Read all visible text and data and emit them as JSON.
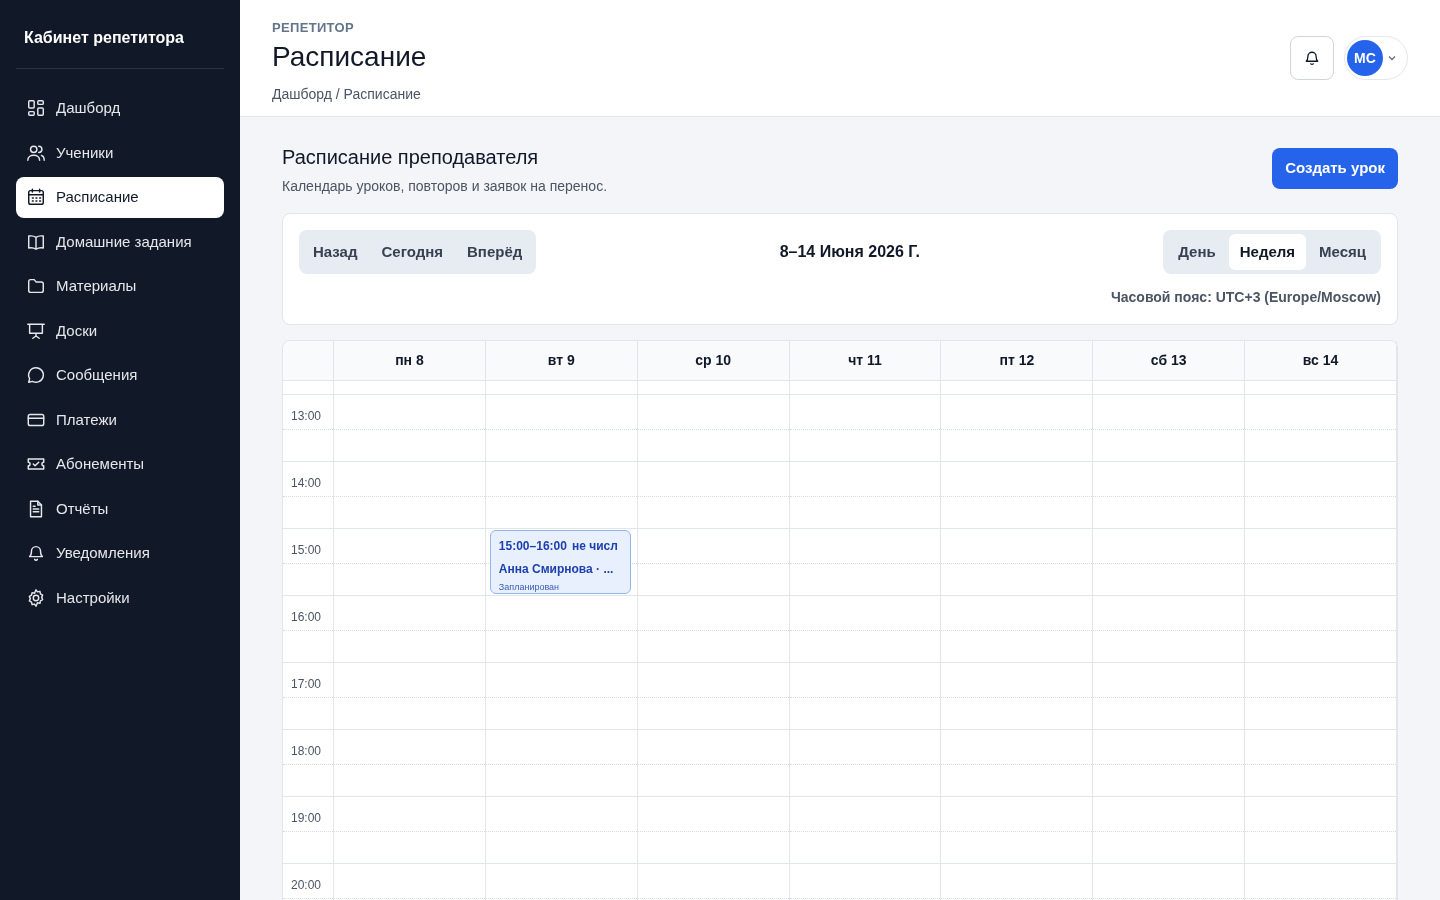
{
  "sidebar": {
    "title": "Кабинет репетитора",
    "items": [
      {
        "label": "Дашборд",
        "selected": false
      },
      {
        "label": "Ученики",
        "selected": false
      },
      {
        "label": "Расписание",
        "selected": true
      },
      {
        "label": "Домашние задания",
        "selected": false
      },
      {
        "label": "Материалы",
        "selected": false
      },
      {
        "label": "Доски",
        "selected": false
      },
      {
        "label": "Сообщения",
        "selected": false
      },
      {
        "label": "Платежи",
        "selected": false
      },
      {
        "label": "Абонементы",
        "selected": false
      },
      {
        "label": "Отчёты",
        "selected": false
      },
      {
        "label": "Уведомления",
        "selected": false
      },
      {
        "label": "Настройки",
        "selected": false
      }
    ]
  },
  "header": {
    "eyebrow": "РЕПЕТИТОР",
    "title": "Расписание",
    "breadcrumb": "Дашборд / Расписание",
    "avatar": "МС"
  },
  "section": {
    "title": "Расписание преподавателя",
    "subtitle": "Календарь уроков, повторов и заявок на перенос.",
    "create_button": "Создать урок"
  },
  "toolbar": {
    "nav_buttons": [
      "Назад",
      "Сегодня",
      "Вперёд"
    ],
    "range": "8–14 Июня 2026 Г.",
    "views": [
      {
        "label": "День",
        "selected": false
      },
      {
        "label": "Неделя",
        "selected": true
      },
      {
        "label": "Месяц",
        "selected": false
      }
    ],
    "timezone": "Часовой пояс: UTC+3 (Europe/Moscow)"
  },
  "calendar": {
    "hours": [
      "13:00",
      "14:00",
      "15:00",
      "16:00",
      "17:00",
      "18:00",
      "19:00",
      "20:00"
    ],
    "days": [
      {
        "label": "пн 8"
      },
      {
        "label": "вт 9",
        "events": [
          {
            "time": "15:00–16:00",
            "subject": "не числ",
            "student": "Анна Смирнова · ...",
            "status": "Запланирован"
          }
        ]
      },
      {
        "label": "ср 10"
      },
      {
        "label": "чт 11"
      },
      {
        "label": "пт 12"
      },
      {
        "label": "сб 13"
      },
      {
        "label": "вс 14"
      }
    ]
  }
}
